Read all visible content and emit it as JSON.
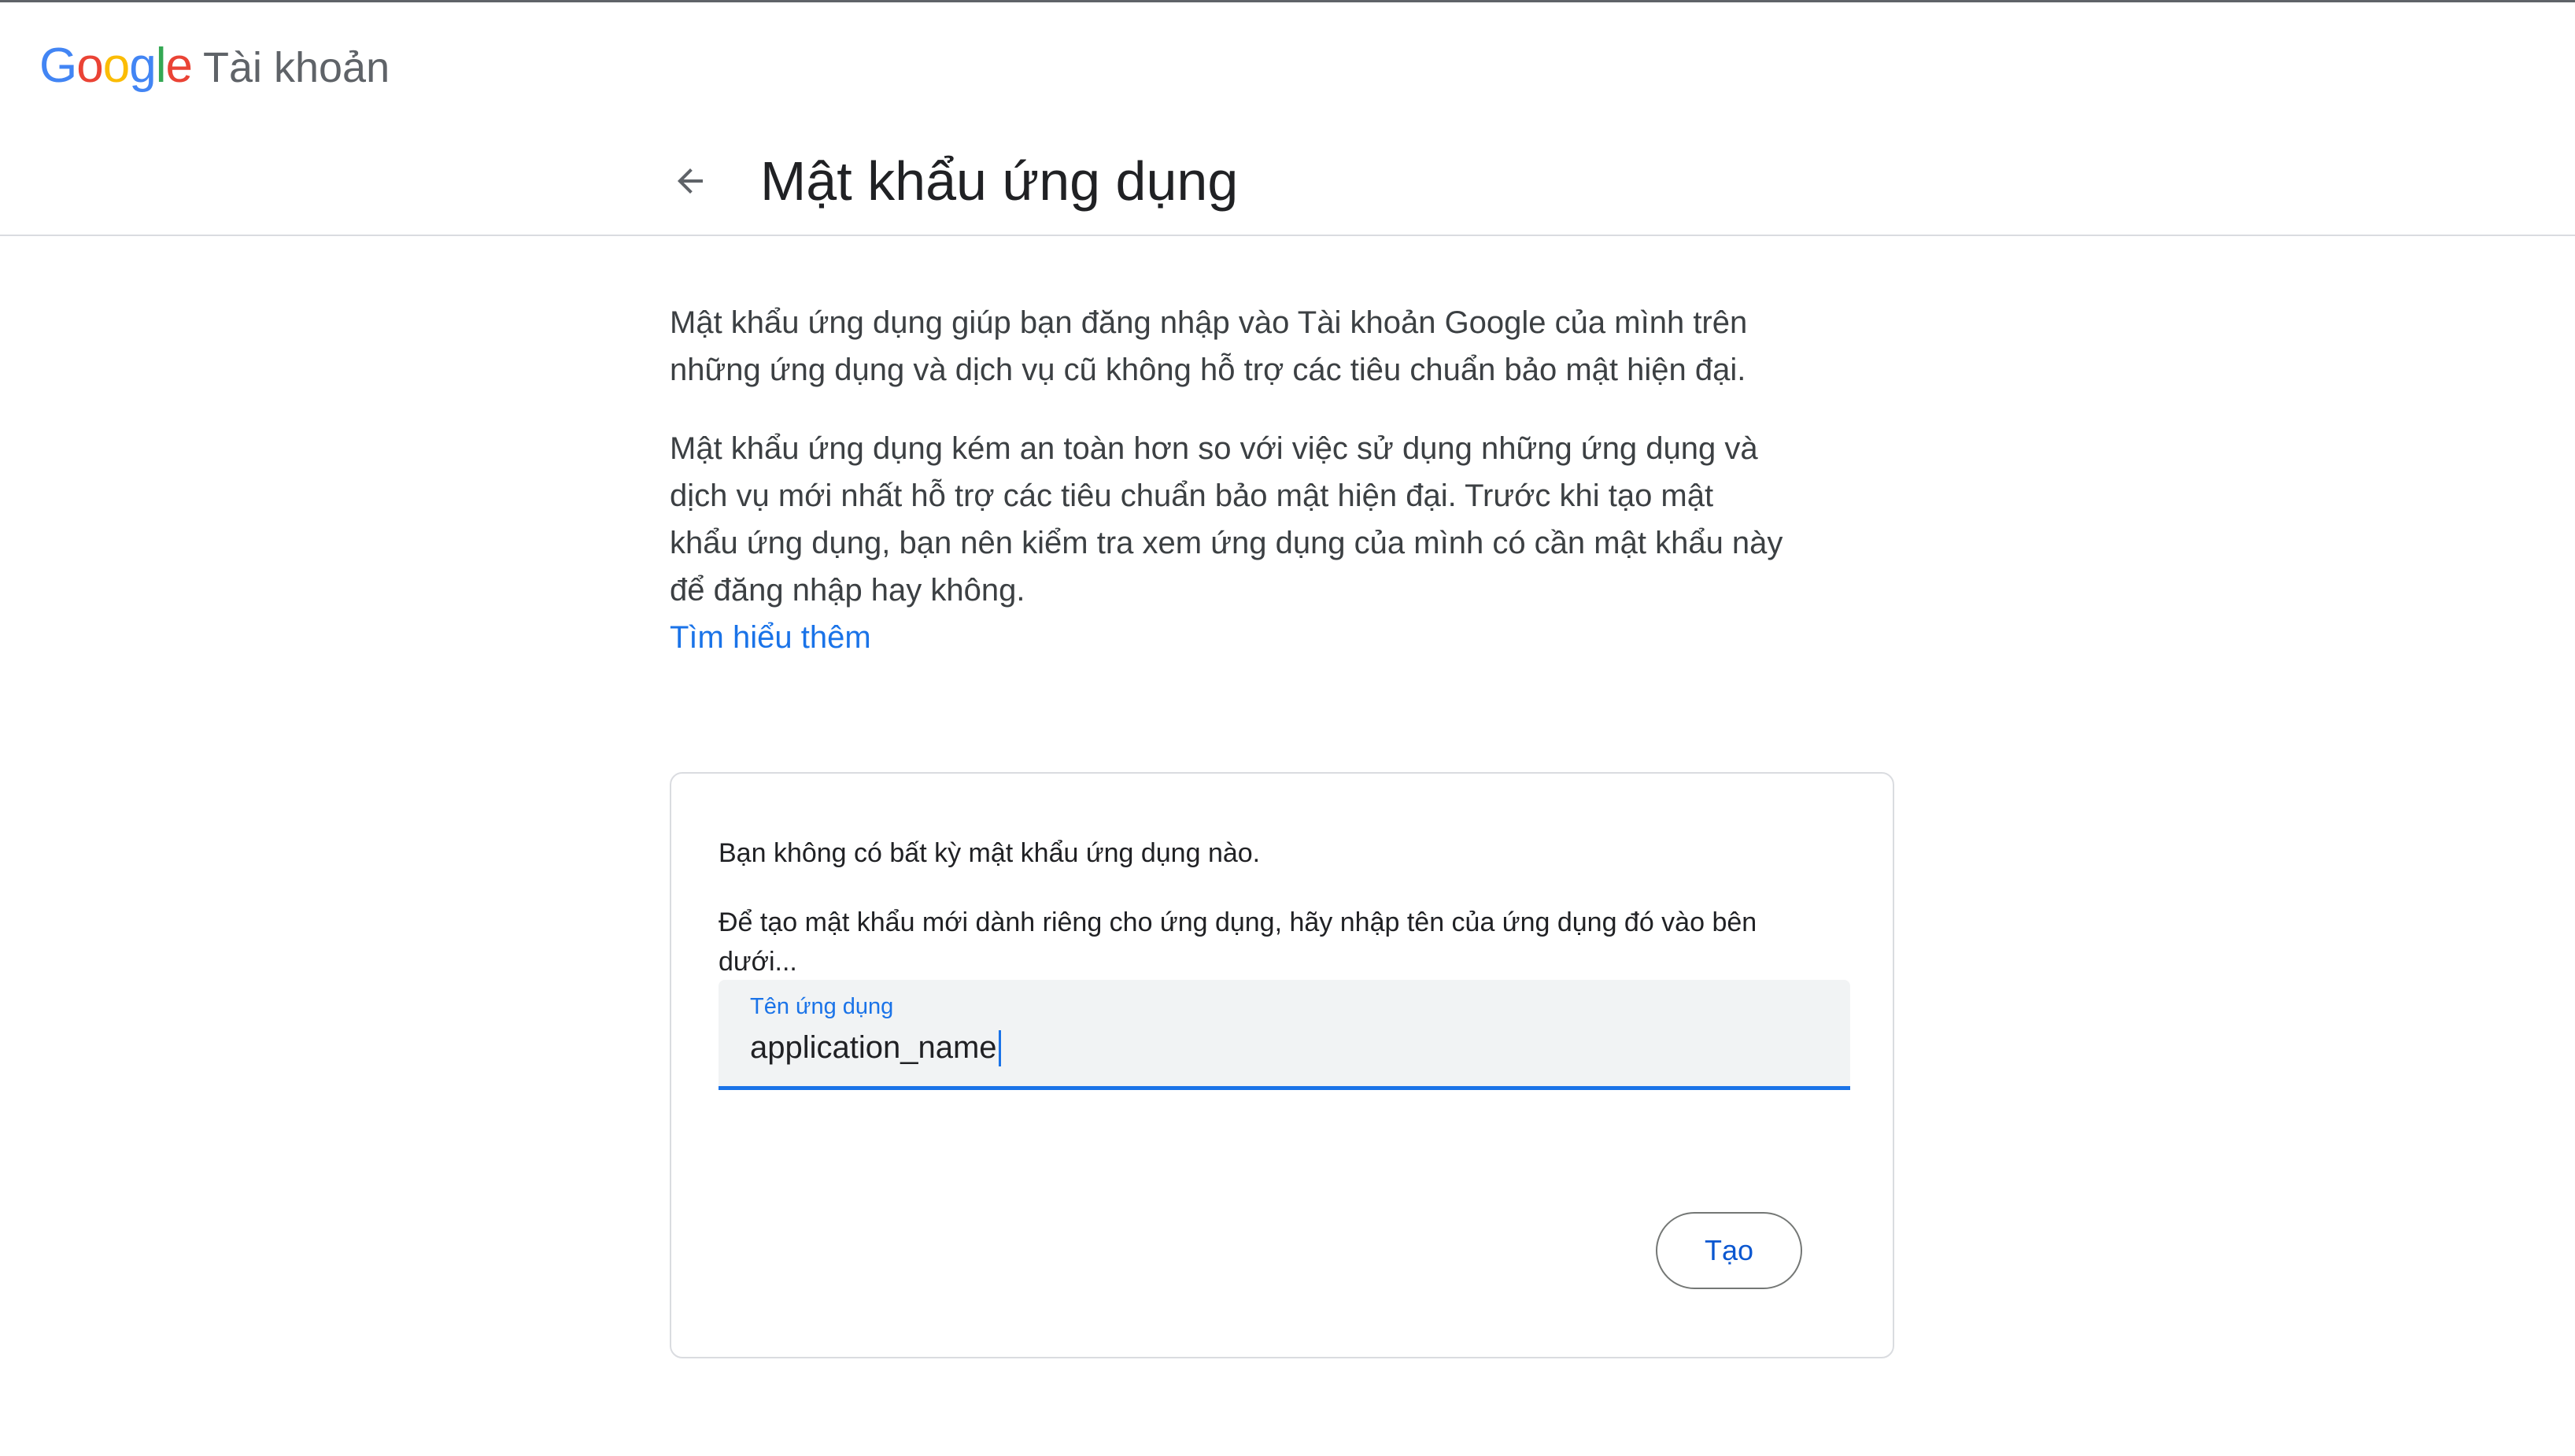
{
  "header": {
    "logo_text": "Google",
    "product_name": "Tài khoản"
  },
  "page": {
    "title": "Mật khẩu ứng dụng",
    "back_icon": "arrow-left-icon"
  },
  "intro": {
    "paragraph1": "Mật khẩu ứng dụng giúp bạn đăng nhập vào Tài khoản Google của mình trên những ứng dụng và dịch vụ cũ không hỗ trợ các tiêu chuẩn bảo mật hiện đại.",
    "paragraph2": "Mật khẩu ứng dụng kém an toàn hơn so với việc sử dụng những ứng dụng và dịch vụ mới nhất hỗ trợ các tiêu chuẩn bảo mật hiện đại. Trước khi tạo mật khẩu ứng dụng, bạn nên kiểm tra xem ứng dụng của mình có cần mật khẩu này để đăng nhập hay không.",
    "learn_more": "Tìm hiểu thêm"
  },
  "card": {
    "empty_message": "Bạn không có bất kỳ mật khẩu ứng dụng nào.",
    "instruction": "Để tạo mật khẩu mới dành riêng cho ứng dụng, hãy nhập tên của ứng dụng đó vào bên dưới...",
    "field": {
      "label": "Tên ứng dụng",
      "value": "application_name"
    },
    "create_button": "Tạo"
  },
  "colors": {
    "accent": "#1a73e8",
    "button_text": "#0b57d0",
    "divider": "#dadce0",
    "field_background": "#f1f3f4"
  }
}
